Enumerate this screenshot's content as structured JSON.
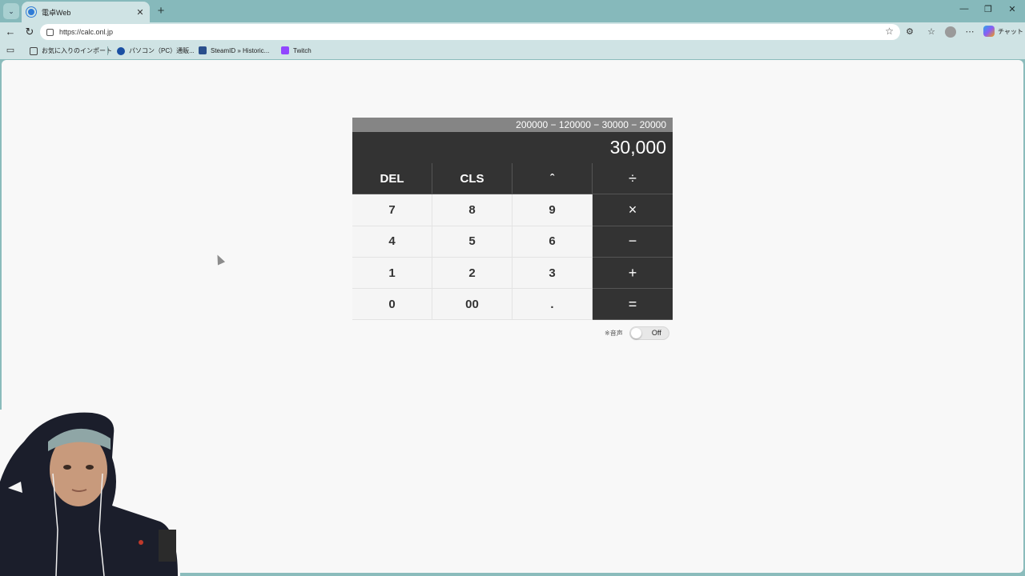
{
  "browser": {
    "tab_title": "電卓Web",
    "tab_close": "✕",
    "new_tab": "+",
    "url": "https://calc.onl.jp",
    "window_controls": {
      "minimize": "—",
      "restore": "❐",
      "close": "✕"
    },
    "copilot_label": "チャット",
    "bookmarks": [
      {
        "label": "お気に入りのインポート",
        "icon": "folder-icon"
      },
      {
        "label": "パソコン（PC）通販...",
        "icon": "site-icon"
      },
      {
        "label": "SteamID » Historic...",
        "icon": "steam-icon"
      },
      {
        "label": "Twitch",
        "icon": "twitch-icon"
      }
    ]
  },
  "calculator": {
    "formula": "200000 − 120000 − 30000 − 20000",
    "display": "30,000",
    "keys": [
      {
        "label": "DEL",
        "style": "dark"
      },
      {
        "label": "CLS",
        "style": "dark"
      },
      {
        "label": "ˆ",
        "style": "dark"
      },
      {
        "label": "÷",
        "style": "op"
      },
      {
        "label": "7",
        "style": "num"
      },
      {
        "label": "8",
        "style": "num"
      },
      {
        "label": "9",
        "style": "num"
      },
      {
        "label": "×",
        "style": "op"
      },
      {
        "label": "4",
        "style": "num"
      },
      {
        "label": "5",
        "style": "num"
      },
      {
        "label": "6",
        "style": "num"
      },
      {
        "label": "−",
        "style": "op"
      },
      {
        "label": "1",
        "style": "num"
      },
      {
        "label": "2",
        "style": "num"
      },
      {
        "label": "3",
        "style": "num"
      },
      {
        "label": "+",
        "style": "op"
      },
      {
        "label": "0",
        "style": "num"
      },
      {
        "label": "00",
        "style": "num"
      },
      {
        "label": ".",
        "style": "num"
      },
      {
        "label": "=",
        "style": "op"
      }
    ],
    "sound_label": "※音声",
    "sound_toggle": "Off"
  }
}
